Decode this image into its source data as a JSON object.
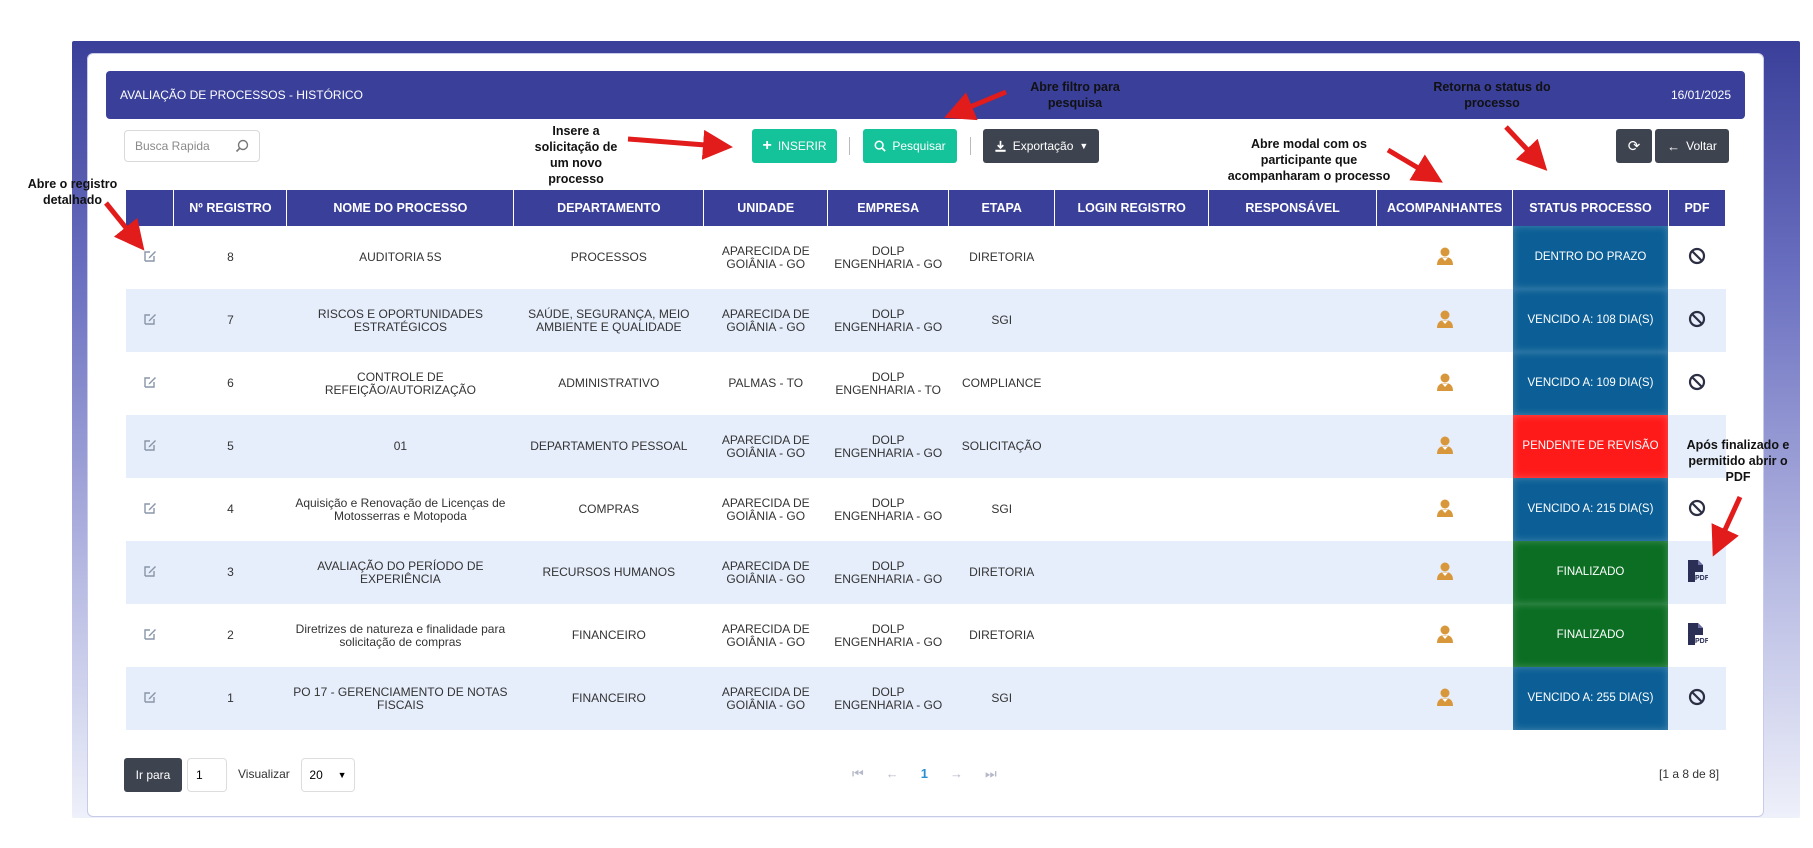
{
  "header": {
    "title": "AVALIAÇÃO DE PROCESSOS - HISTÓRICO",
    "date": "16/01/2025"
  },
  "toolbar": {
    "search_placeholder": "Busca Rapida",
    "insert_label": "INSERIR",
    "search_label": "Pesquisar",
    "export_label": "Exportação",
    "back_label": "Voltar"
  },
  "table": {
    "columns": [
      "",
      "Nº REGISTRO",
      "NOME DO PROCESSO",
      "DEPARTAMENTO",
      "UNIDADE",
      "EMPRESA",
      "ETAPA",
      "LOGIN REGISTRO",
      "RESPONSÁVEL",
      "ACOMPANHANTES",
      "STATUS PROCESSO",
      "PDF"
    ],
    "rows": [
      {
        "registro": "8",
        "nome": "AUDITORIA 5S",
        "departamento": "PROCESSOS",
        "unidade": "APARECIDA DE GOIÂNIA - GO",
        "empresa": "DOLP ENGENHARIA - GO",
        "etapa": "DIRETORIA",
        "status": "DENTRO DO PRAZO",
        "status_color": "#0b5f96",
        "pdf": "ban"
      },
      {
        "registro": "7",
        "nome": "RISCOS E OPORTUNIDADES ESTRATÉGICOS",
        "departamento": "SAÚDE, SEGURANÇA, MEIO AMBIENTE E QUALIDADE",
        "unidade": "APARECIDA DE GOIÂNIA - GO",
        "empresa": "DOLP ENGENHARIA - GO",
        "etapa": "SGI",
        "status": "VENCIDO A: 108 DIA(S)",
        "status_color": "#0b5f96",
        "pdf": "ban"
      },
      {
        "registro": "6",
        "nome": "CONTROLE DE REFEIÇÃO/AUTORIZAÇÃO",
        "departamento": "ADMINISTRATIVO",
        "unidade": "PALMAS - TO",
        "empresa": "DOLP ENGENHARIA - TO",
        "etapa": "COMPLIANCE",
        "status": "VENCIDO A: 109 DIA(S)",
        "status_color": "#0b5f96",
        "pdf": "ban"
      },
      {
        "registro": "5",
        "nome": "01",
        "departamento": "DEPARTAMENTO PESSOAL",
        "unidade": "APARECIDA DE GOIÂNIA - GO",
        "empresa": "DOLP ENGENHARIA - GO",
        "etapa": "SOLICITAÇÃO",
        "status": "PENDENTE DE REVISÃO",
        "status_color": "#ff1a1a",
        "pdf": "none"
      },
      {
        "registro": "4",
        "nome": "Aquisição e Renovação de Licenças de Motosserras e Motopoda",
        "departamento": "COMPRAS",
        "unidade": "APARECIDA DE GOIÂNIA - GO",
        "empresa": "DOLP ENGENHARIA - GO",
        "etapa": "SGI",
        "status": "VENCIDO A: 215 DIA(S)",
        "status_color": "#0b5f96",
        "pdf": "ban"
      },
      {
        "registro": "3",
        "nome": "AVALIAÇÃO DO PERÍODO DE EXPERIÊNCIA",
        "departamento": "RECURSOS HUMANOS",
        "unidade": "APARECIDA DE GOIÂNIA - GO",
        "empresa": "DOLP ENGENHARIA - GO",
        "etapa": "DIRETORIA",
        "status": "FINALIZADO",
        "status_color": "#0b6e23",
        "pdf": "pdf"
      },
      {
        "registro": "2",
        "nome": "Diretrizes de natureza e finalidade para solicitação de compras",
        "departamento": "FINANCEIRO",
        "unidade": "APARECIDA DE GOIÂNIA - GO",
        "empresa": "DOLP ENGENHARIA - GO",
        "etapa": "DIRETORIA",
        "status": "FINALIZADO",
        "status_color": "#0b6e23",
        "pdf": "pdf"
      },
      {
        "registro": "1",
        "nome": "PO 17 - GERENCIAMENTO DE NOTAS FISCAIS",
        "departamento": "FINANCEIRO",
        "unidade": "APARECIDA DE GOIÂNIA - GO",
        "empresa": "DOLP ENGENHARIA - GO",
        "etapa": "SGI",
        "status": "VENCIDO A: 255 DIA(S)",
        "status_color": "#0b5f96",
        "pdf": "ban"
      }
    ]
  },
  "pagination": {
    "goto_label": "Ir para",
    "goto_value": "1",
    "view_label": "Visualizar",
    "page_size": "20",
    "current_page": "1",
    "range": "[1 a 8 de 8]"
  },
  "annotations": {
    "open_record": "Abre o registro detalhado",
    "insert": "Insere a solicitação de um novo processo",
    "filter": "Abre filtro para pesquisa",
    "companions": "Abre modal com os participante que acompanharam o processo",
    "status": "Retorna o status do processo",
    "pdf": "Após finalizado e permitido abrir o PDF"
  },
  "colors": {
    "header": "#3a3f99",
    "accent": "#14c39a",
    "dark_button": "#3e444f",
    "arrow": "#e21b1b"
  }
}
